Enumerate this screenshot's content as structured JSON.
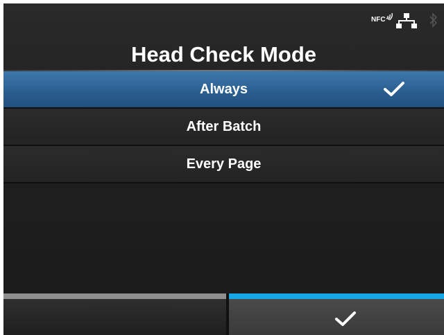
{
  "status": {
    "nfc_label": "NFC",
    "icons": [
      "nfc-icon",
      "network-icon",
      "bluetooth-icon"
    ]
  },
  "title": "Head Check Mode",
  "options": [
    {
      "label": "Always",
      "selected": true
    },
    {
      "label": "After Batch",
      "selected": false
    },
    {
      "label": "Every Page",
      "selected": false
    }
  ],
  "softkeys": {
    "left": {
      "label": ""
    },
    "right": {
      "icon": "checkmark-icon"
    }
  },
  "colors": {
    "selected_row": "#2b5f91",
    "left_softkey_bar": "#8f8f8f",
    "right_softkey_bar": "#16a7e6",
    "background": "#222222"
  }
}
